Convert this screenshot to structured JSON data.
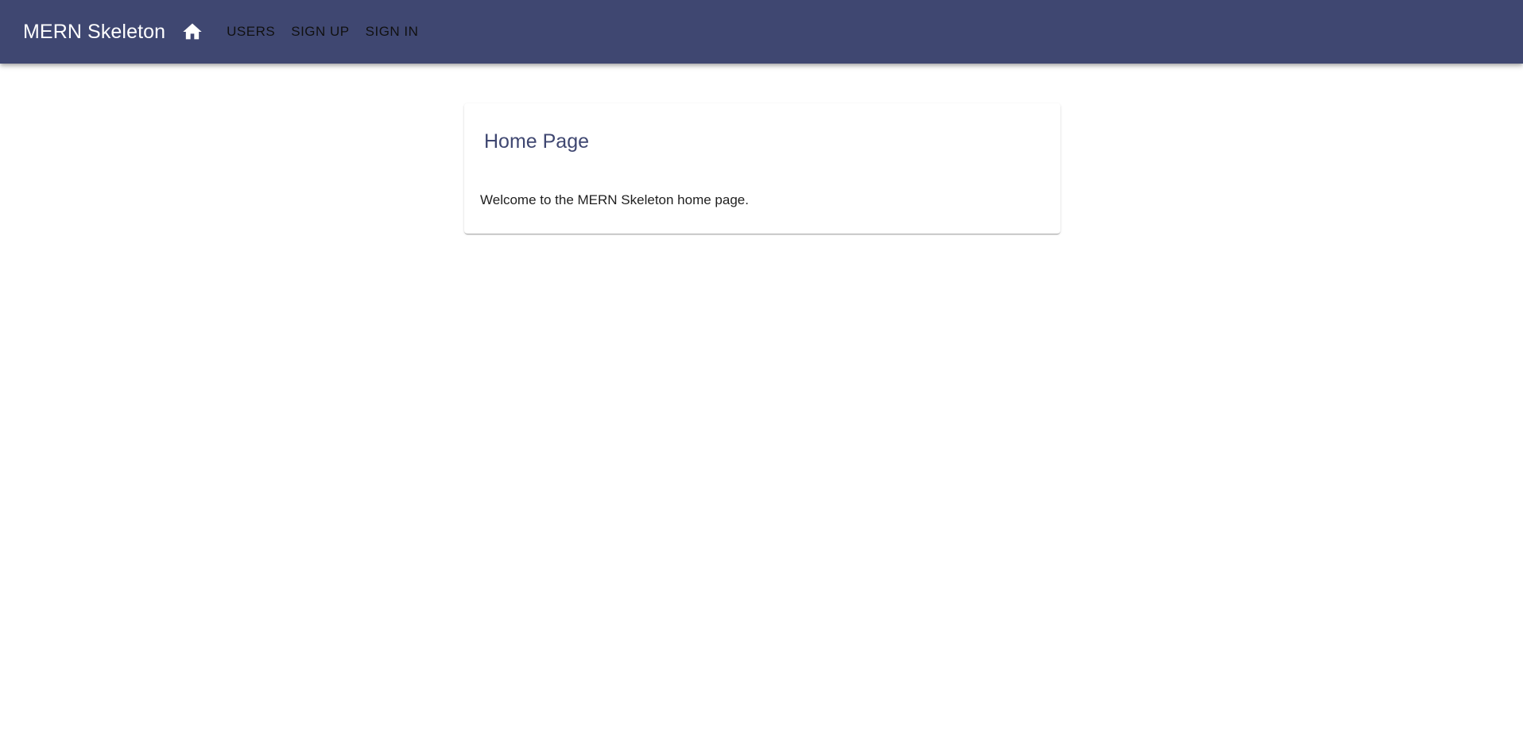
{
  "header": {
    "title": "MERN Skeleton",
    "home_icon": "home-icon",
    "nav": [
      {
        "label": "USERS"
      },
      {
        "label": "SIGN UP"
      },
      {
        "label": "SIGN IN"
      }
    ]
  },
  "main": {
    "card": {
      "title": "Home Page",
      "text": "Welcome to the MERN Skeleton home page."
    }
  },
  "colors": {
    "appbar": "#3f4771",
    "title_accent": "#3f4771"
  }
}
